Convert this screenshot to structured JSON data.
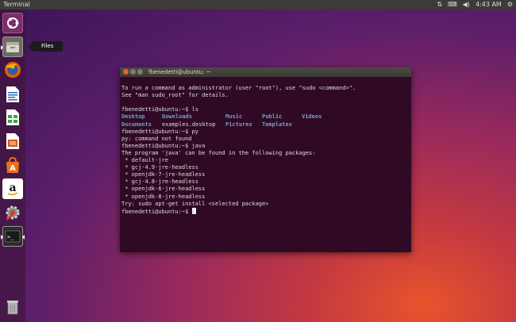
{
  "top_panel": {
    "app_title": "Terminal",
    "time": "4:43 AM",
    "icons": [
      "network-icon",
      "keyboard-icon",
      "volume-icon",
      "power-gear-icon"
    ]
  },
  "launcher": {
    "items": [
      {
        "name": "ubuntu-dash",
        "icon": "ubuntu-logo-icon"
      },
      {
        "name": "files",
        "icon": "files-icon"
      },
      {
        "name": "firefox",
        "icon": "firefox-icon"
      },
      {
        "name": "libreoffice-writer",
        "icon": "writer-icon"
      },
      {
        "name": "libreoffice-calc",
        "icon": "calc-icon"
      },
      {
        "name": "libreoffice-impress",
        "icon": "impress-icon"
      },
      {
        "name": "software-center",
        "icon": "software-center-icon"
      },
      {
        "name": "amazon",
        "icon": "amazon-icon"
      },
      {
        "name": "system-settings",
        "icon": "settings-icon"
      },
      {
        "name": "terminal",
        "icon": "terminal-icon"
      },
      {
        "name": "trash",
        "icon": "trash-icon"
      }
    ],
    "tooltip": "Files"
  },
  "terminal": {
    "title": "fbenedetti@ubuntu: ~",
    "lines": [
      "To run a command as administrator (user \"root\"), use \"sudo <command>\".",
      "See \"man sudo_root\" for details.",
      "",
      "fbenedetti@ubuntu:~$ ls"
    ],
    "ls_output": [
      [
        "Desktop",
        "Downloads",
        "Music",
        "Public",
        "Videos"
      ],
      [
        "Documents",
        "examples.desktop",
        "Pictures",
        "Templates",
        ""
      ]
    ],
    "lines_after": [
      "fbenedetti@ubuntu:~$ py",
      "py: command not found",
      "fbenedetti@ubuntu:~$ java",
      "The program 'java' can be found in the following packages:",
      " * default-jre",
      " * gcj-4.9-jre-headless",
      " * openjdk-7-jre-headless",
      " * gcj-4.8-jre-headless",
      " * openjdk-6-jre-headless",
      " * openjdk-8-jre-headless",
      "Try: sudo apt-get install <selected package>"
    ],
    "prompt": "fbenedetti@ubuntu:~$ "
  },
  "colors": {
    "terminal_bg": "#300a24",
    "terminal_fg": "#dedede",
    "ls_dir_blue": "#729fcf",
    "close_button": "#e9612f",
    "panel_bg": "#3c3b37"
  }
}
